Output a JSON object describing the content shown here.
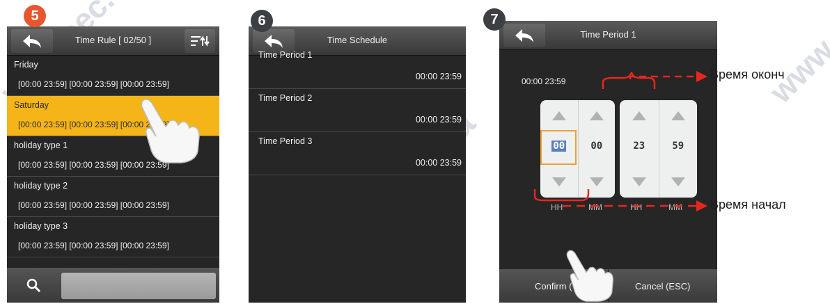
{
  "watermark": {
    "text": "www.sec.ua"
  },
  "steps": {
    "s5": "5",
    "s6": "6",
    "s7": "7"
  },
  "screen1": {
    "title": "Time Rule [ 02/50 ]",
    "icons": {
      "back": "back-arrow-icon",
      "sort": "sort-icon",
      "search": "search-icon"
    },
    "rows": [
      {
        "day": "Friday",
        "times": "[00:00 23:59] [00:00 23:59] [00:00 23:59]",
        "selected": false
      },
      {
        "day": "Saturday",
        "times": "[00:00 23:59] [00:00 23:59] [00:00 23:59]",
        "selected": true
      },
      {
        "day": "holiday type 1",
        "times": "[00:00 23:59] [00:00 23:59] [00:00 23:59]",
        "selected": false
      },
      {
        "day": "holiday type 2",
        "times": "[00:00 23:59] [00:00 23:59] [00:00 23:59]",
        "selected": false
      },
      {
        "day": "holiday type 3",
        "times": "[00:00 23:59] [00:00 23:59] [00:00 23:59]",
        "selected": false
      }
    ],
    "search_value": ""
  },
  "screen2": {
    "title": "Time Schedule",
    "periods": [
      {
        "name": "Time Period 1",
        "range": "00:00  23:59"
      },
      {
        "name": "Time Period 2",
        "range": "00:00  23:59"
      },
      {
        "name": "Time Period 3",
        "range": "00:00  23:59"
      }
    ]
  },
  "screen3": {
    "title": "Time Period 1",
    "range_display": "00:00  23:59",
    "spinners": [
      {
        "unit": "HH",
        "value": "00",
        "focused": true
      },
      {
        "unit": "MM",
        "value": "00",
        "focused": false
      },
      {
        "unit": "HH",
        "value": "23",
        "focused": false
      },
      {
        "unit": "MM",
        "value": "59",
        "focused": false
      }
    ],
    "confirm_label": "Confirm (",
    "cancel_label": "Cancel (ESC)"
  },
  "annotations": {
    "end_time": "Время оконч",
    "start_time": "Время начал",
    "arrow_color": "#e8261f"
  },
  "colors": {
    "selected_row": "#f5b418",
    "screen_bg": "#262626",
    "focus_outline": "#e8a23a"
  }
}
